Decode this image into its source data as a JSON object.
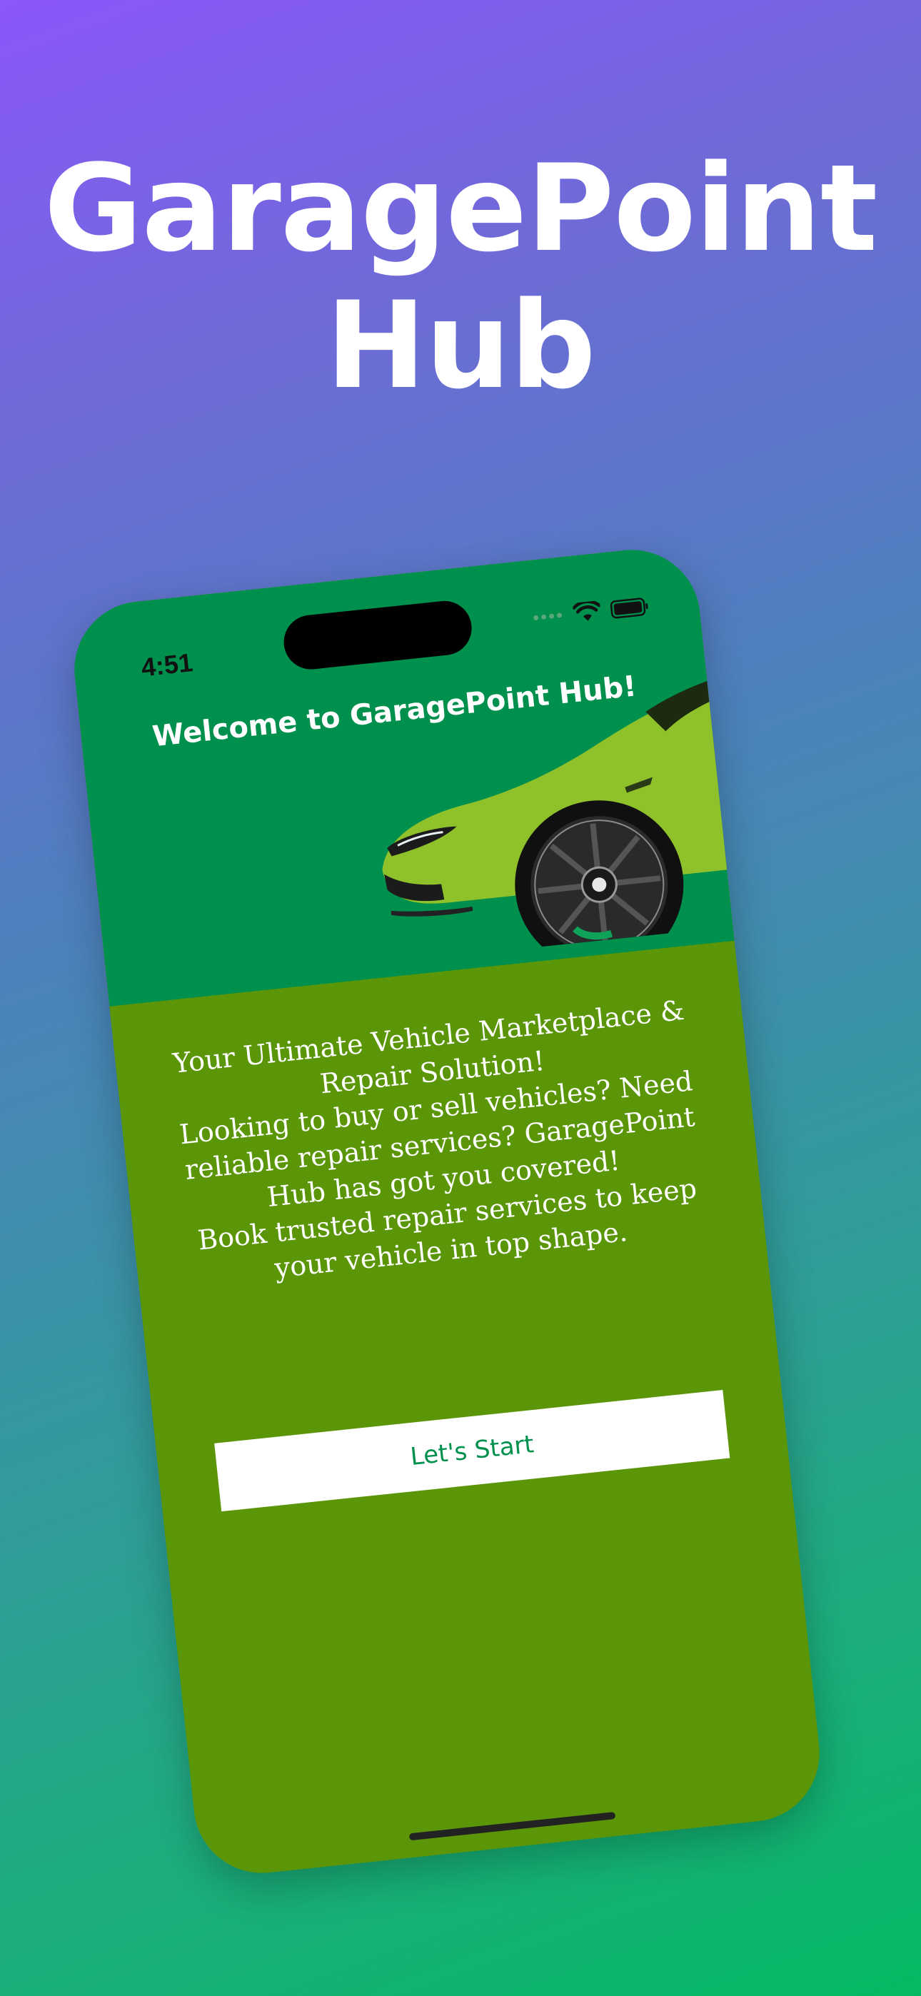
{
  "headline": {
    "line1": "GaragePoint",
    "line2": "Hub"
  },
  "status_bar": {
    "time": "4:51",
    "icons": [
      "signal-dots-icon",
      "wifi-icon",
      "battery-icon"
    ]
  },
  "welcome": {
    "title": "Welcome to GaragePoint Hub!"
  },
  "intro": {
    "tagline": "Your Ultimate Vehicle Marketplace & Repair Solution!",
    "paragraph1": "Looking to buy or sell vehicles? Need reliable repair services? GaragePoint Hub has got you covered!",
    "paragraph2": "Book trusted repair services to keep your vehicle in top shape."
  },
  "actions": {
    "start_label": "Let's Start"
  },
  "colors": {
    "screen_top": "#00904e",
    "screen_bottom": "#5b9608",
    "button_text": "#00904e",
    "car_body": "#8fc22a"
  }
}
